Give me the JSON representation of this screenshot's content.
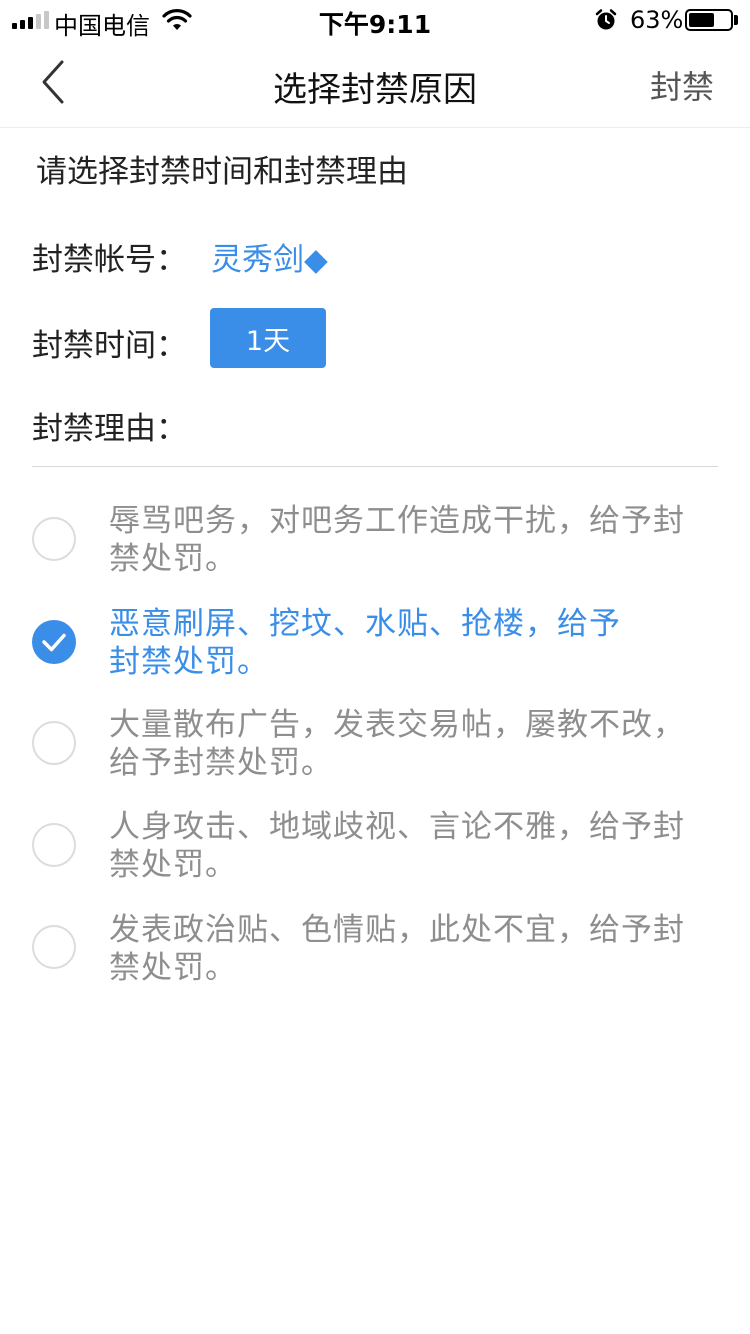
{
  "status_bar": {
    "carrier": "中国电信",
    "time": "下午9:11",
    "battery_percent": "63%",
    "battery_level": 0.63,
    "icons": [
      "signal-icon",
      "wifi-icon",
      "alarm-icon",
      "battery-icon"
    ]
  },
  "nav": {
    "back_icon": "chevron-left-icon",
    "title": "选择封禁原因",
    "action_label": "封禁"
  },
  "form": {
    "instruction": "请选择封禁时间和封禁理由",
    "account_label": "封禁帐号：",
    "account_value": "灵秀剑◆",
    "duration_label": "封禁时间：",
    "duration_value": "1天",
    "reason_label": "封禁理由："
  },
  "reasons": [
    {
      "text": "辱骂吧务，对吧务工作造成干扰，给予封禁处罚。",
      "selected": false
    },
    {
      "text": "恶意刷屏、挖坟、水贴、抢楼，给予封禁处罚。",
      "selected": true
    },
    {
      "text": "大量散布广告，发表交易帖，屡教不改，给予封禁处罚。",
      "selected": false
    },
    {
      "text": "人身攻击、地域歧视、言论不雅，给予封禁处罚。",
      "selected": false
    },
    {
      "text": "发表政治贴、色情贴，此处不宜，给予封禁处罚。",
      "selected": false
    }
  ],
  "colors": {
    "accent": "#3b8ee8",
    "text_primary": "#222222",
    "text_muted": "#8e8e8e"
  }
}
